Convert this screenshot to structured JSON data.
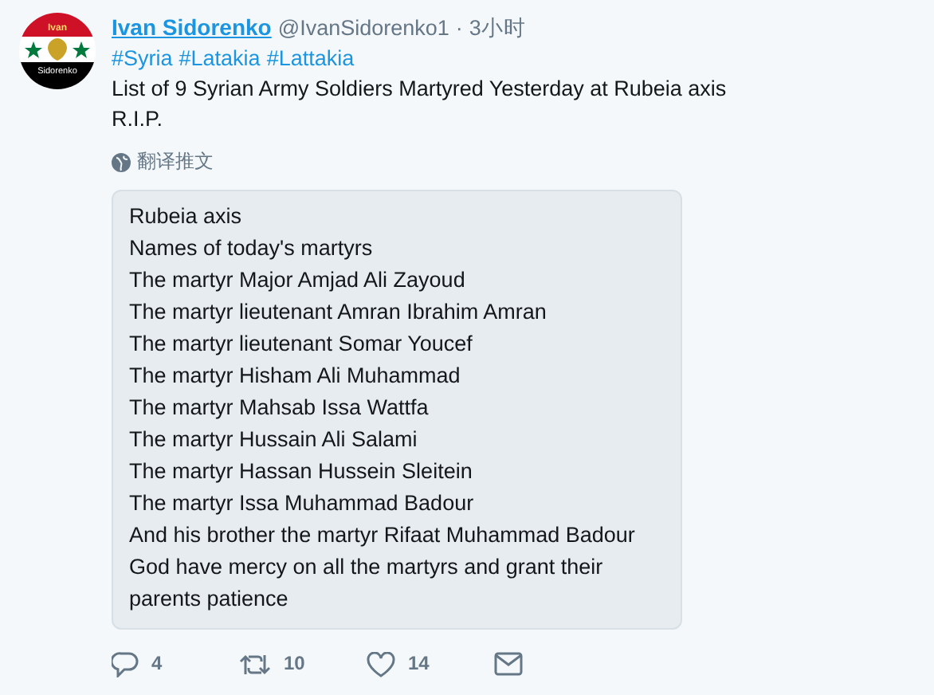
{
  "tweet": {
    "avatar": {
      "top_text": "Ivan",
      "bottom_text": "Sidorenko"
    },
    "author": "Ivan Sidorenko",
    "handle": "@IvanSidorenko1",
    "separator": "·",
    "time": "3小时",
    "hashtags": [
      "#Syria",
      "#Latakia",
      "#Lattakia"
    ],
    "text_lines": [
      "List of 9 Syrian Army Soldiers Martyred Yesterday at Rubeia axis",
      "R.I.P."
    ],
    "translate": "翻译推文",
    "quoted_lines": [
      "Rubeia axis",
      "Names of today's martyrs",
      "The martyr Major Amjad Ali Zayoud",
      "The martyr lieutenant Amran Ibrahim Amran",
      "The martyr lieutenant Somar Youcef",
      "The martyr Hisham Ali Muhammad",
      "The martyr Mahsab Issa Wattfa",
      "The martyr Hussain Ali Salami",
      "The martyr Hassan Hussein Sleitein",
      "The martyr Issa Muhammad Badour",
      "And his brother the martyr Rifaat Muhammad Badour",
      "God have mercy on all the martyrs and grant their parents patience"
    ],
    "actions": [
      {
        "kind": "reply",
        "count": "4"
      },
      {
        "kind": "retweet",
        "count": "10"
      },
      {
        "kind": "like",
        "count": "14"
      },
      {
        "kind": "message"
      }
    ]
  }
}
